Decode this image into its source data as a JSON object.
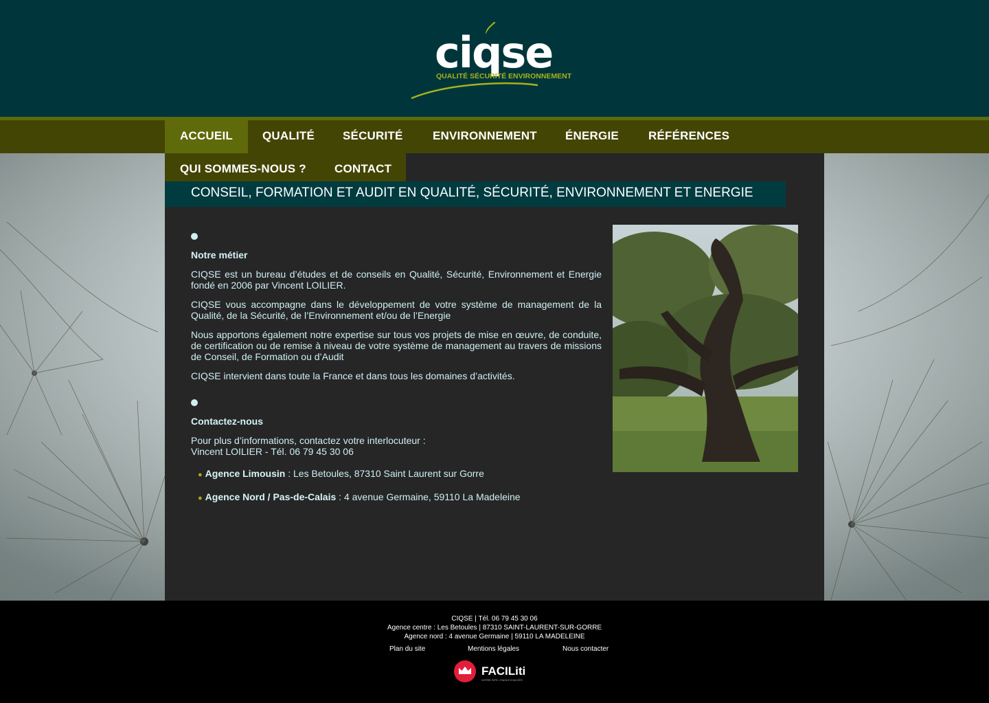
{
  "logo": {
    "name": "ciqse",
    "tagline": "QUALITÉ SÉCURITÉ ENVIRONNEMENT"
  },
  "nav": {
    "items": [
      {
        "label": "ACCUEIL"
      },
      {
        "label": "QUALITÉ"
      },
      {
        "label": "SÉCURITÉ"
      },
      {
        "label": "ENVIRONNEMENT"
      },
      {
        "label": "ÉNERGIE"
      },
      {
        "label": "RÉFÉRENCES"
      },
      {
        "label": "QUI SOMMES-NOUS ?"
      },
      {
        "label": "CONTACT"
      }
    ],
    "active": "ACCUEIL"
  },
  "banner": {
    "title": "CONSEIL, FORMATION ET AUDIT EN QUALITÉ, SÉCURITÉ, ENVIRONNEMENT ET ENERGIE"
  },
  "metier": {
    "heading": "Notre métier",
    "paragraphs": [
      "CIQSE est un bureau d’études et de conseils en Qualité, Sécurité, Environnement et Energie fondé en 2006 par Vincent LOILIER.",
      "CIQSE vous accompagne dans le développement de votre système de management de la Qualité, de la Sécurité, de l’Environnement et/ou de l’Energie",
      "Nous apportons également notre expertise sur tous vos projets de mise en œuvre, de conduite, de certification ou de remise à niveau de votre système de management au travers de missions de Conseil, de Formation ou d’Audit",
      "CIQSE intervient dans toute la France et dans tous les domaines d’activités."
    ]
  },
  "contact": {
    "heading": "Contactez-nous",
    "intro_line1": "Pour plus d’informations, contactez votre interlocuteur :",
    "intro_line2": "Vincent LOILIER - Tél. 06 79 45 30 06",
    "agencies": [
      {
        "name": "Agence Limousin",
        "address": " : Les Betoules, 87310 Saint Laurent sur Gorre"
      },
      {
        "name": "Agence Nord / Pas-de-Calais",
        "address": " : 4 avenue Germaine, 59110 La Madeleine"
      }
    ]
  },
  "footer": {
    "line1": "CIQSE | Tél. 06 79 45 30 06",
    "line2": "Agence centre : Les Betoules | 87310 SAINT-LAURENT-SUR-GORRE",
    "line3": "Agence nord : 4 avenue Germaine | 59110 LA MADELEINE",
    "links": [
      "Plan du site",
      "Mentions légales",
      "Nous contacter"
    ],
    "badge": {
      "name": "FACILiti",
      "tagline": "VOTRE SITE • FACILE D'ACCÈS"
    }
  },
  "colors": {
    "header_bg": "#00363b",
    "nav_bg": "#434505",
    "nav_active": "#5f6a0a",
    "content_bg": "#262626",
    "banner_bg": "#003b40",
    "accent_green": "#a7b31b"
  },
  "icons": [
    "leaf-icon",
    "bullet-icon",
    "crown-icon"
  ]
}
